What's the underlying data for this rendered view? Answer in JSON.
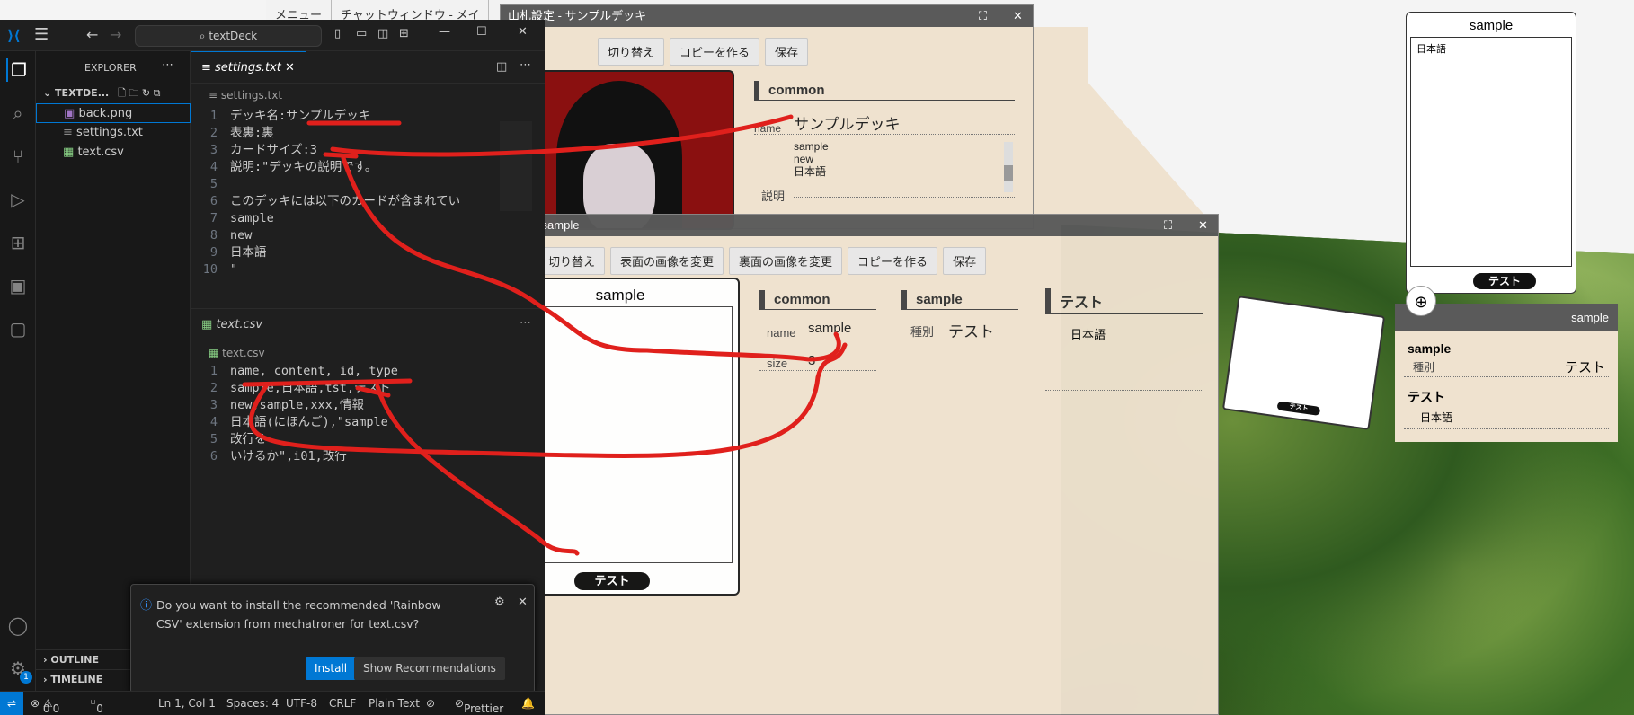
{
  "topTabs": [
    "メニュー",
    "チャットウィンドウ - メイ"
  ],
  "deckWin": {
    "title": "山札設定 - サンプルデッキ",
    "buttons": [
      "切り替え",
      "コピーを作る",
      "保存"
    ],
    "section": "common",
    "name_label": "name",
    "name_value": "サンプルデッキ",
    "list": [
      "sample",
      "new",
      "日本語"
    ],
    "desc_label": "説明"
  },
  "cardWin": {
    "title": "設定 - sample",
    "buttons": [
      "切り替え",
      "表面の画像を変更",
      "裏面の画像を変更",
      "コピーを作る",
      "保存"
    ],
    "cardTitle": "sample",
    "cardPill": "テスト",
    "common": {
      "header": "common",
      "name_label": "name",
      "name_value": "sample",
      "size_label": "size",
      "size_value": "3"
    },
    "sample": {
      "header": "sample",
      "kind_label": "種別",
      "kind_value": "テスト"
    },
    "test": {
      "header": "テスト",
      "value": "日本語"
    }
  },
  "rightCard": {
    "title": "sample",
    "body": "日本語",
    "pill": "テスト"
  },
  "rightInfo": {
    "bar": "sample",
    "header1": "sample",
    "kind_label": "種別",
    "kind_value": "テスト",
    "header2": "テスト",
    "value2": "日本語"
  },
  "vscode": {
    "search": "textDeck",
    "explorer": "EXPLORER",
    "folder": "TEXTDE...",
    "files": [
      "back.png",
      "settings.txt",
      "text.csv"
    ],
    "outline": "OUTLINE",
    "timeline": "TIMELINE",
    "tab1": "settings.txt",
    "bc1": "settings.txt",
    "settings_lines": [
      "デッキ名:サンプルデッキ",
      "表裏:裏",
      "カードサイズ:3",
      "説明:\"デッキの説明です。",
      "",
      "このデッキには以下のカードが含まれてい",
      "sample",
      "new",
      "日本語",
      "\""
    ],
    "tab2": "text.csv",
    "bc2": "text.csv",
    "csv_lines": [
      "name, content, id, type",
      "sample,日本語,tst,テスト",
      "new,sample,xxx,情報",
      "日本語(にほんご),\"sample",
      "改行を",
      "いけるか\",i01,改行"
    ],
    "notif_text": "Do you want to install the recommended 'Rainbow CSV' extension from mechatroner for text.csv?",
    "install": "Install",
    "show_rec": "Show Recommendations",
    "status": {
      "errors": "0",
      "warnings": "0",
      "ports": "0",
      "pos": "Ln 1, Col 1",
      "spaces": "Spaces: 4",
      "enc": "UTF-8",
      "eol": "CRLF",
      "lang": "Plain Text",
      "prettier": "Prettier"
    },
    "badge": "1"
  },
  "colors": {
    "accentRed": "#e0201c",
    "vscodeBlue": "#0078d4"
  }
}
